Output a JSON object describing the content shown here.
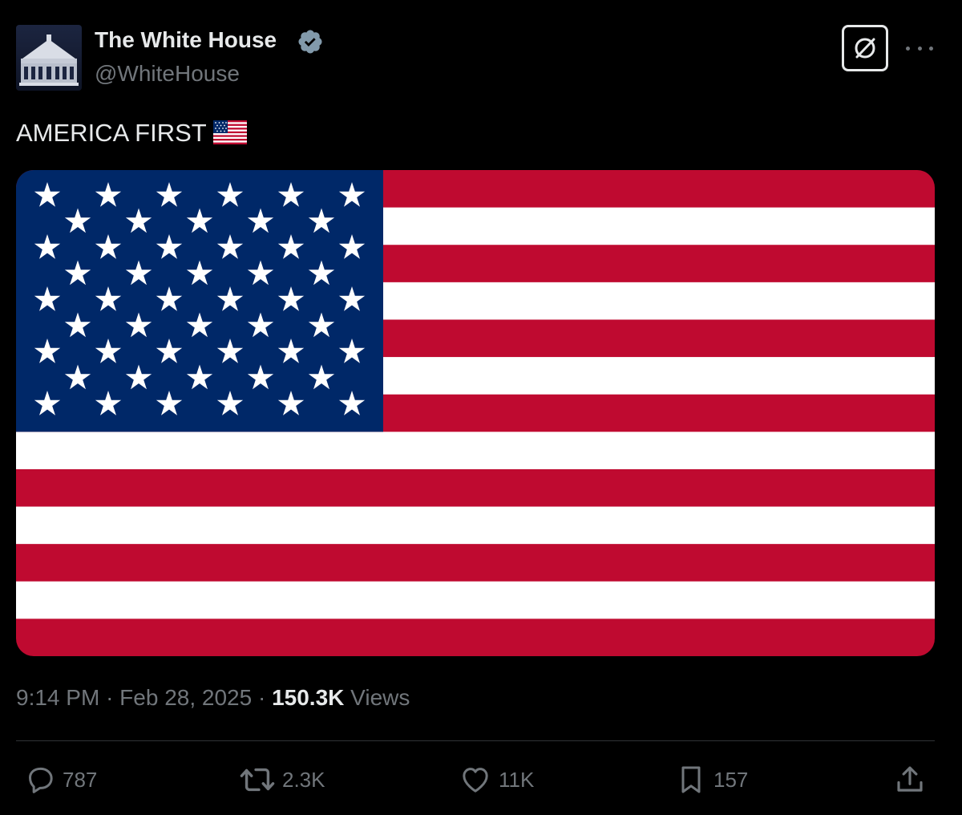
{
  "author": {
    "display_name": "The White House",
    "handle": "@WhiteHouse",
    "verified_icon": "verified-badge-icon",
    "avatar_icon": "white-house-building-icon"
  },
  "header_actions": {
    "grok_icon": "grok-icon",
    "more_icon": "more-options-icon"
  },
  "tweet": {
    "text": "AMERICA FIRST",
    "emoji": "flag-us-icon"
  },
  "media": {
    "image": "us-flag-image",
    "colors": {
      "red": "#bf0a30",
      "white": "#ffffff",
      "blue": "#002868"
    }
  },
  "meta": {
    "time": "9:14 PM",
    "separator": "·",
    "date": "Feb 28, 2025",
    "views_count": "150.3K",
    "views_label": "Views"
  },
  "actions": {
    "reply": {
      "icon": "reply-icon",
      "count": "787"
    },
    "repost": {
      "icon": "repost-icon",
      "count": "2.3K"
    },
    "like": {
      "icon": "heart-icon",
      "count": "11K"
    },
    "bookmark": {
      "icon": "bookmark-icon",
      "count": "157"
    },
    "share": {
      "icon": "share-icon"
    }
  },
  "colors": {
    "background": "#000000",
    "primary_text": "#e7e9ea",
    "secondary_text": "#71767b",
    "divider": "#2f3336"
  }
}
